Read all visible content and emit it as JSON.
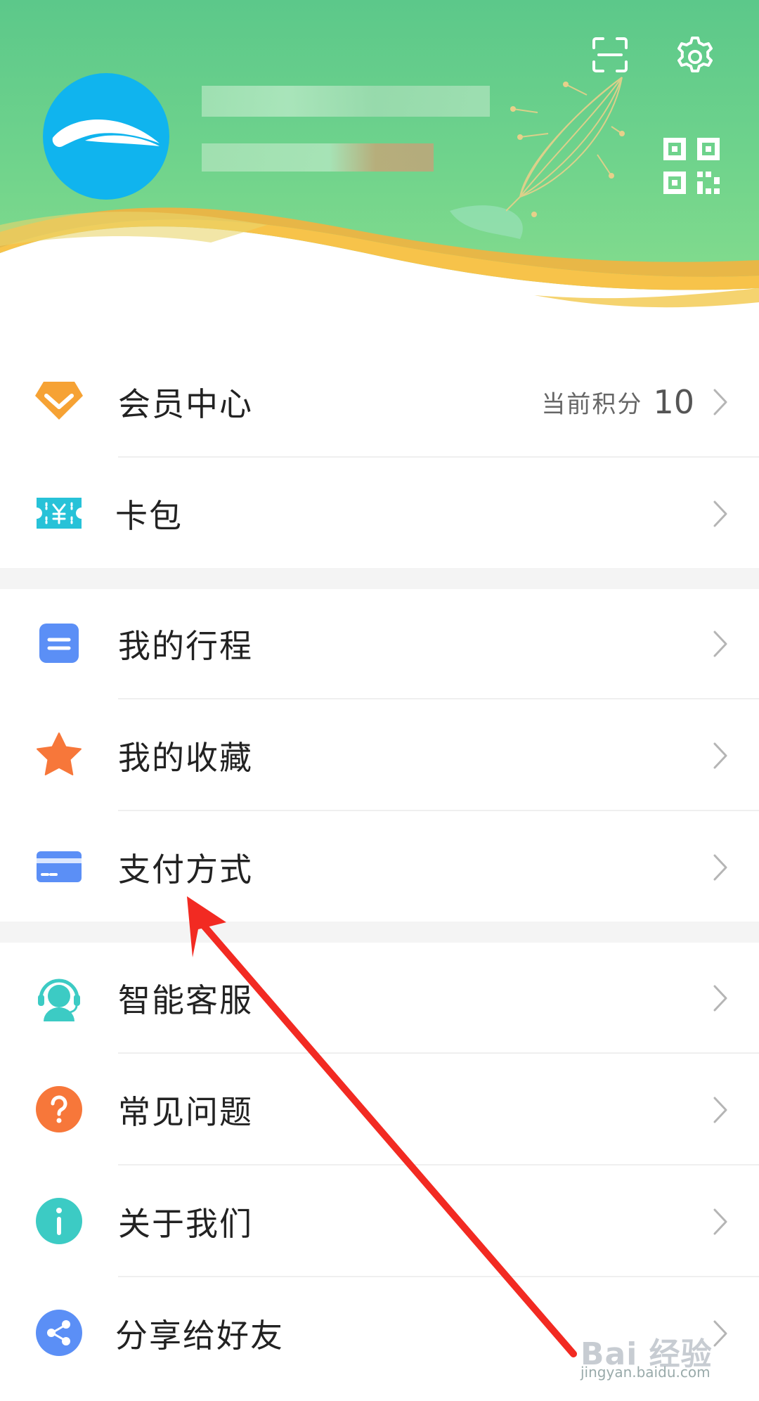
{
  "colors": {
    "header_green": "#6fd38c",
    "avatar_blue": "#10b4ee",
    "orange": "#f6a234",
    "blue": "#5b8ff6",
    "teal": "#3ccbc4",
    "annotation_red": "#f22a22"
  },
  "header": {
    "icons": [
      "scan-icon",
      "gear-icon",
      "qr-code-icon"
    ]
  },
  "section1": [
    {
      "label": "会员中心",
      "icon": "diamond-icon",
      "extra_label": "当前积分",
      "extra_value": "10"
    },
    {
      "label": "卡包",
      "icon": "ticket-icon"
    }
  ],
  "section2": [
    {
      "label": "我的行程",
      "icon": "itinerary-icon"
    },
    {
      "label": "我的收藏",
      "icon": "star-icon"
    },
    {
      "label": "支付方式",
      "icon": "card-icon"
    }
  ],
  "section3": [
    {
      "label": "智能客服",
      "icon": "headset-icon"
    },
    {
      "label": "常见问题",
      "icon": "question-icon"
    },
    {
      "label": "关于我们",
      "icon": "info-icon"
    },
    {
      "label": "分享给好友",
      "icon": "share-icon"
    }
  ],
  "watermark": {
    "brand": "Bai 经验",
    "url": "jingyan.baidu.com"
  }
}
